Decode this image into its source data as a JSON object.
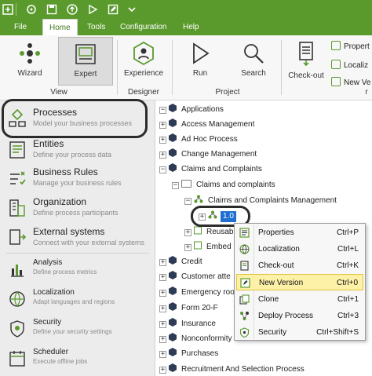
{
  "quick_access": {
    "icons": [
      "app-icon",
      "refresh-icon",
      "save-icon",
      "upload-icon",
      "run-icon",
      "edit-icon",
      "dropdown-icon"
    ]
  },
  "menu": {
    "items": [
      "File",
      "Home",
      "Tools",
      "Configuration",
      "Help"
    ],
    "active": "Home"
  },
  "ribbon": {
    "view": {
      "label": "View",
      "buttons": [
        "Wizard",
        "Expert"
      ]
    },
    "designer": {
      "label": "Designer",
      "buttons": [
        "Experience"
      ]
    },
    "project": {
      "label": "Project",
      "buttons": [
        "Run",
        "Search"
      ]
    },
    "checkout": {
      "label": "Check-out"
    },
    "small_items": [
      "Propert",
      "Localiz",
      "New Ve"
    ],
    "small_trailing": "r"
  },
  "colors": {
    "accent_green": "#5a9a2c",
    "selection_blue": "#1e6fd0",
    "menu_highlight": "#fdf1a8"
  },
  "nav": [
    {
      "title": "Processes",
      "subtitle": "Model your business processes",
      "icon": "processes-icon"
    },
    {
      "title": "Entities",
      "subtitle": "Define your process data",
      "icon": "entities-icon"
    },
    {
      "title": "Business Rules",
      "subtitle": "Manage your business rules",
      "icon": "business-rules-icon"
    },
    {
      "title": "Organization",
      "subtitle": "Define process participants",
      "icon": "organization-icon"
    },
    {
      "title": "External systems",
      "subtitle": "Connect with your external systems",
      "icon": "external-systems-icon"
    },
    {
      "title": "Analysis",
      "subtitle": "Define process metrics",
      "icon": "analysis-icon"
    },
    {
      "title": "Localization",
      "subtitle": "Adapt languages and regions",
      "icon": "localization-icon"
    },
    {
      "title": "Security",
      "subtitle": "Define your security settings",
      "icon": "security-icon"
    },
    {
      "title": "Scheduler",
      "subtitle": "Execute offline jobs",
      "icon": "scheduler-icon"
    }
  ],
  "tree": {
    "root": "Applications",
    "items": [
      "Access Management",
      "Ad Hoc Process",
      "Change Management",
      "Claims and Complaints",
      "Claims and complaints",
      "Claims and Complaints Management",
      "1.0",
      "Reusab",
      "Embed",
      "Credit",
      "Customer atte",
      "Emergency roo",
      "Form 20-F",
      "Insurance",
      "Nonconformity",
      "Purchases",
      "Recruitment And Selection Process"
    ],
    "toggles": {
      "expand": "+",
      "collapse": "−"
    }
  },
  "context_menu": {
    "items": [
      {
        "label": "Properties",
        "shortcut": "Ctrl+P",
        "icon": "properties-icon"
      },
      {
        "label": "Localization",
        "shortcut": "Ctrl+L",
        "icon": "localization-icon"
      },
      {
        "label": "Check-out",
        "shortcut": "Ctrl+K",
        "icon": "checkout-icon"
      },
      {
        "label": "New Version",
        "shortcut": "Ctrl+0",
        "icon": "new-version-icon"
      },
      {
        "label": "Clone",
        "shortcut": "Ctrl+1",
        "icon": "clone-icon"
      },
      {
        "label": "Deploy Process",
        "shortcut": "Ctrl+3",
        "icon": "deploy-icon"
      },
      {
        "label": "Security",
        "shortcut": "Ctrl+Shift+S",
        "icon": "security-icon"
      }
    ],
    "active": "New Version"
  }
}
